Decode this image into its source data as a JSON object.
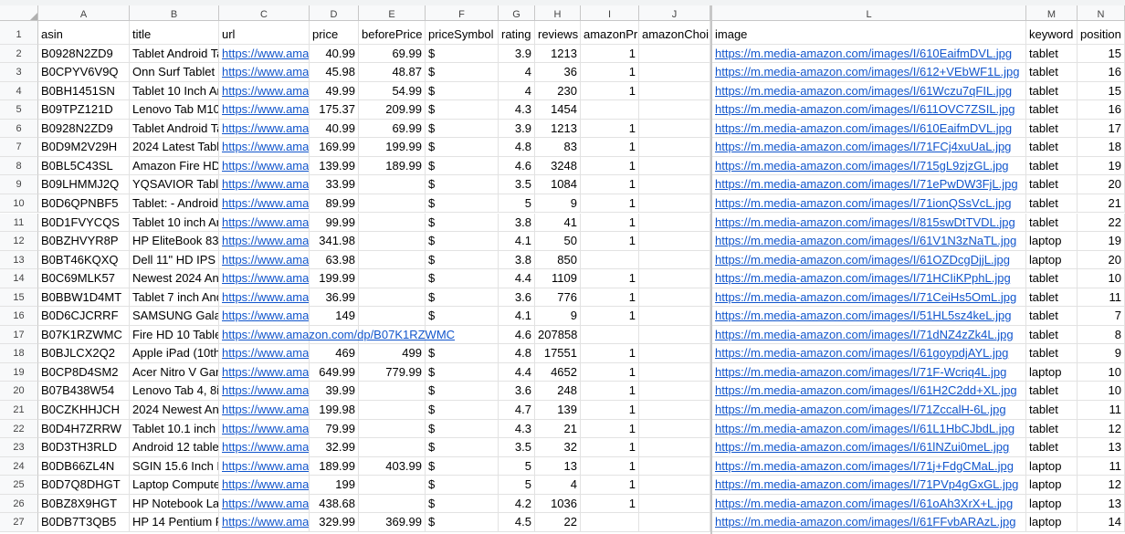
{
  "columns": [
    {
      "letter": "A",
      "header": "asin"
    },
    {
      "letter": "B",
      "header": "title"
    },
    {
      "letter": "C",
      "header": "url"
    },
    {
      "letter": "D",
      "header": "price"
    },
    {
      "letter": "E",
      "header": "beforePrice"
    },
    {
      "letter": "F",
      "header": "priceSymbol"
    },
    {
      "letter": "G",
      "header": "rating"
    },
    {
      "letter": "H",
      "header": "reviews"
    },
    {
      "letter": "I",
      "header": "amazonPri"
    },
    {
      "letter": "J",
      "header": "amazonChoi"
    },
    {
      "letter": "L",
      "header": "image"
    },
    {
      "letter": "M",
      "header": "keyword"
    },
    {
      "letter": "N",
      "header": "position"
    }
  ],
  "rows": [
    {
      "n": "2",
      "asin": "B0928N2ZD9",
      "title": "Tablet Android Ta",
      "url": "https://www.ama",
      "price": "40.99",
      "beforePrice": "69.99",
      "symbol": "$",
      "rating": "3.9",
      "reviews": "1213",
      "prime": "1",
      "choice": "",
      "image": "https://m.media-amazon.com/images/I/610EaifmDVL.jpg",
      "keyword": "tablet",
      "position": "15"
    },
    {
      "n": "3",
      "asin": "B0CPYV6V9Q",
      "title": "Onn Surf Tablet (",
      "url": "https://www.ama",
      "price": "45.98",
      "beforePrice": "48.87",
      "symbol": "$",
      "rating": "4",
      "reviews": "36",
      "prime": "1",
      "choice": "",
      "image": "https://m.media-amazon.com/images/I/612+VEbWF1L.jpg",
      "keyword": "tablet",
      "position": "16"
    },
    {
      "n": "4",
      "asin": "B0BH1451SN",
      "title": "Tablet 10 Inch Ar",
      "url": "https://www.ama",
      "price": "49.99",
      "beforePrice": "54.99",
      "symbol": "$",
      "rating": "4",
      "reviews": "230",
      "prime": "1",
      "choice": "",
      "image": "https://m.media-amazon.com/images/I/61Wczu7qFIL.jpg",
      "keyword": "tablet",
      "position": "15"
    },
    {
      "n": "5",
      "asin": "B09TPZ121D",
      "title": "Lenovo Tab M10",
      "url": "https://www.ama",
      "price": "175.37",
      "beforePrice": "209.99",
      "symbol": "$",
      "rating": "4.3",
      "reviews": "1454",
      "prime": "",
      "choice": "",
      "image": "https://m.media-amazon.com/images/I/611OVC7ZSIL.jpg",
      "keyword": "tablet",
      "position": "16"
    },
    {
      "n": "6",
      "asin": "B0928N2ZD9",
      "title": "Tablet Android Ta",
      "url": "https://www.ama",
      "price": "40.99",
      "beforePrice": "69.99",
      "symbol": "$",
      "rating": "3.9",
      "reviews": "1213",
      "prime": "1",
      "choice": "",
      "image": "https://m.media-amazon.com/images/I/610EaifmDVL.jpg",
      "keyword": "tablet",
      "position": "17"
    },
    {
      "n": "7",
      "asin": "B0D9M2V29H",
      "title": "2024 Latest Table",
      "url": "https://www.ama",
      "price": "169.99",
      "beforePrice": "199.99",
      "symbol": "$",
      "rating": "4.8",
      "reviews": "83",
      "prime": "1",
      "choice": "",
      "image": "https://m.media-amazon.com/images/I/71FCj4xuUaL.jpg",
      "keyword": "tablet",
      "position": "18"
    },
    {
      "n": "8",
      "asin": "B0BL5C43SL",
      "title": "Amazon Fire HD",
      "url": "https://www.ama",
      "price": "139.99",
      "beforePrice": "189.99",
      "symbol": "$",
      "rating": "4.6",
      "reviews": "3248",
      "prime": "1",
      "choice": "",
      "image": "https://m.media-amazon.com/images/I/715gL9zjzGL.jpg",
      "keyword": "tablet",
      "position": "19"
    },
    {
      "n": "9",
      "asin": "B09LHMMJ2Q",
      "title": "YQSAVIOR Table",
      "url": "https://www.ama",
      "price": "33.99",
      "beforePrice": "",
      "symbol": "$",
      "rating": "3.5",
      "reviews": "1084",
      "prime": "1",
      "choice": "",
      "image": "https://m.media-amazon.com/images/I/71ePwDW3FjL.jpg",
      "keyword": "tablet",
      "position": "20"
    },
    {
      "n": "10",
      "asin": "B0D6QPNBF5",
      "title": "Tablet: - Android",
      "url": "https://www.ama",
      "price": "89.99",
      "beforePrice": "",
      "symbol": "$",
      "rating": "5",
      "reviews": "9",
      "prime": "1",
      "choice": "",
      "image": "https://m.media-amazon.com/images/I/71ionQSsVcL.jpg",
      "keyword": "tablet",
      "position": "21"
    },
    {
      "n": "11",
      "asin": "B0D1FVYCQS",
      "title": "Tablet 10 inch Ar",
      "url": "https://www.ama",
      "price": "99.99",
      "beforePrice": "",
      "symbol": "$",
      "rating": "3.8",
      "reviews": "41",
      "prime": "1",
      "choice": "",
      "image": "https://m.media-amazon.com/images/I/815swDtTVDL.jpg",
      "keyword": "tablet",
      "position": "22"
    },
    {
      "n": "12",
      "asin": "B0BZHVYR8P",
      "title": "HP EliteBook 83",
      "url": "https://www.ama",
      "price": "341.98",
      "beforePrice": "",
      "symbol": "$",
      "rating": "4.1",
      "reviews": "50",
      "prime": "1",
      "choice": "",
      "image": "https://m.media-amazon.com/images/I/61V1N3zNaTL.jpg",
      "keyword": "laptop",
      "position": "19"
    },
    {
      "n": "13",
      "asin": "B0BT46KQXQ",
      "title": "Dell 11\" HD IPS",
      "url": "https://www.ama",
      "price": "63.98",
      "beforePrice": "",
      "symbol": "$",
      "rating": "3.8",
      "reviews": "850",
      "prime": "",
      "choice": "",
      "image": "https://m.media-amazon.com/images/I/61OZDcgDjjL.jpg",
      "keyword": "laptop",
      "position": "20"
    },
    {
      "n": "14",
      "asin": "B0C69MLK57",
      "title": "Newest 2024 An",
      "url": "https://www.ama",
      "price": "199.99",
      "beforePrice": "",
      "symbol": "$",
      "rating": "4.4",
      "reviews": "1109",
      "prime": "1",
      "choice": "",
      "image": "https://m.media-amazon.com/images/I/71HCIiKPphL.jpg",
      "keyword": "tablet",
      "position": "10"
    },
    {
      "n": "15",
      "asin": "B0BBW1D4MT",
      "title": "Tablet 7 inch And",
      "url": "https://www.ama",
      "price": "36.99",
      "beforePrice": "",
      "symbol": "$",
      "rating": "3.6",
      "reviews": "776",
      "prime": "1",
      "choice": "",
      "image": "https://m.media-amazon.com/images/I/71CeiHs5OmL.jpg",
      "keyword": "tablet",
      "position": "11"
    },
    {
      "n": "16",
      "asin": "B0D6CJCRRF",
      "title": "SAMSUNG Gala",
      "url": "https://www.ama",
      "price": "149",
      "beforePrice": "",
      "symbol": "$",
      "rating": "4.1",
      "reviews": "9",
      "prime": "1",
      "choice": "",
      "image": "https://m.media-amazon.com/images/I/51HL5sz4keL.jpg",
      "keyword": "tablet",
      "position": "7"
    },
    {
      "n": "17",
      "asin": "B07K1RZWMC",
      "title": "Fire HD 10 Table",
      "url": "https://www.amazon.com/dp/B07K1RZWMC",
      "price": "",
      "beforePrice": "",
      "symbol": "",
      "rating": "4.6",
      "reviews": "207858",
      "prime": "",
      "choice": "",
      "image": "https://m.media-amazon.com/images/I/71dNZ4zZk4L.jpg",
      "keyword": "tablet",
      "position": "8",
      "urlOverflow": true
    },
    {
      "n": "18",
      "asin": "B0BJLCX2Q2",
      "title": "Apple iPad (10th",
      "url": "https://www.ama",
      "price": "469",
      "beforePrice": "499",
      "symbol": "$",
      "rating": "4.8",
      "reviews": "17551",
      "prime": "1",
      "choice": "",
      "image": "https://m.media-amazon.com/images/I/61goypdjAYL.jpg",
      "keyword": "tablet",
      "position": "9"
    },
    {
      "n": "19",
      "asin": "B0CP8D4SM2",
      "title": "Acer Nitro V Gar",
      "url": "https://www.ama",
      "price": "649.99",
      "beforePrice": "779.99",
      "symbol": "$",
      "rating": "4.4",
      "reviews": "4652",
      "prime": "1",
      "choice": "",
      "image": "https://m.media-amazon.com/images/I/71F-Wcriq4L.jpg",
      "keyword": "laptop",
      "position": "10"
    },
    {
      "n": "20",
      "asin": "B07B438W54",
      "title": "Lenovo Tab 4, 8i",
      "url": "https://www.ama",
      "price": "39.99",
      "beforePrice": "",
      "symbol": "$",
      "rating": "3.6",
      "reviews": "248",
      "prime": "1",
      "choice": "",
      "image": "https://m.media-amazon.com/images/I/61H2C2dd+XL.jpg",
      "keyword": "tablet",
      "position": "10"
    },
    {
      "n": "21",
      "asin": "B0CZKHHJCH",
      "title": "2024 Newest An",
      "url": "https://www.ama",
      "price": "199.98",
      "beforePrice": "",
      "symbol": "$",
      "rating": "4.7",
      "reviews": "139",
      "prime": "1",
      "choice": "",
      "image": "https://m.media-amazon.com/images/I/71ZccalH-6L.jpg",
      "keyword": "tablet",
      "position": "11"
    },
    {
      "n": "22",
      "asin": "B0D4H7ZRRW",
      "title": "Tablet 10.1 inch ,",
      "url": "https://www.ama",
      "price": "79.99",
      "beforePrice": "",
      "symbol": "$",
      "rating": "4.3",
      "reviews": "21",
      "prime": "1",
      "choice": "",
      "image": "https://m.media-amazon.com/images/I/61L1HbCJbdL.jpg",
      "keyword": "tablet",
      "position": "12"
    },
    {
      "n": "23",
      "asin": "B0D3TH3RLD",
      "title": "Android 12 table",
      "url": "https://www.ama",
      "price": "32.99",
      "beforePrice": "",
      "symbol": "$",
      "rating": "3.5",
      "reviews": "32",
      "prime": "1",
      "choice": "",
      "image": "https://m.media-amazon.com/images/I/61lNZui0meL.jpg",
      "keyword": "tablet",
      "position": "13"
    },
    {
      "n": "24",
      "asin": "B0DB66ZL4N",
      "title": "SGIN 15.6 Inch L",
      "url": "https://www.ama",
      "price": "189.99",
      "beforePrice": "403.99",
      "symbol": "$",
      "rating": "5",
      "reviews": "13",
      "prime": "1",
      "choice": "",
      "image": "https://m.media-amazon.com/images/I/71j+FdgCMaL.jpg",
      "keyword": "laptop",
      "position": "11"
    },
    {
      "n": "25",
      "asin": "B0D7Q8DHGT",
      "title": "Laptop Compute",
      "url": "https://www.ama",
      "price": "199",
      "beforePrice": "",
      "symbol": "$",
      "rating": "5",
      "reviews": "4",
      "prime": "1",
      "choice": "",
      "image": "https://m.media-amazon.com/images/I/71PVp4gGxGL.jpg",
      "keyword": "laptop",
      "position": "12"
    },
    {
      "n": "26",
      "asin": "B0BZ8X9HGT",
      "title": "HP Notebook La",
      "url": "https://www.ama",
      "price": "438.68",
      "beforePrice": "",
      "symbol": "$",
      "rating": "4.2",
      "reviews": "1036",
      "prime": "1",
      "choice": "",
      "image": "https://m.media-amazon.com/images/I/61oAh3XrX+L.jpg",
      "keyword": "laptop",
      "position": "13"
    },
    {
      "n": "27",
      "asin": "B0DB7T3QB5",
      "title": "HP 14 Pentium F",
      "url": "https://www.ama",
      "price": "329.99",
      "beforePrice": "369.99",
      "symbol": "$",
      "rating": "4.5",
      "reviews": "22",
      "prime": "",
      "choice": "",
      "image": "https://m.media-amazon.com/images/I/61FFvbARAzL.jpg",
      "keyword": "laptop",
      "position": "14"
    }
  ],
  "colors": {
    "link": "#1155cc",
    "header_bg": "#f8f9fa",
    "grid_line": "#e2e2e2"
  }
}
